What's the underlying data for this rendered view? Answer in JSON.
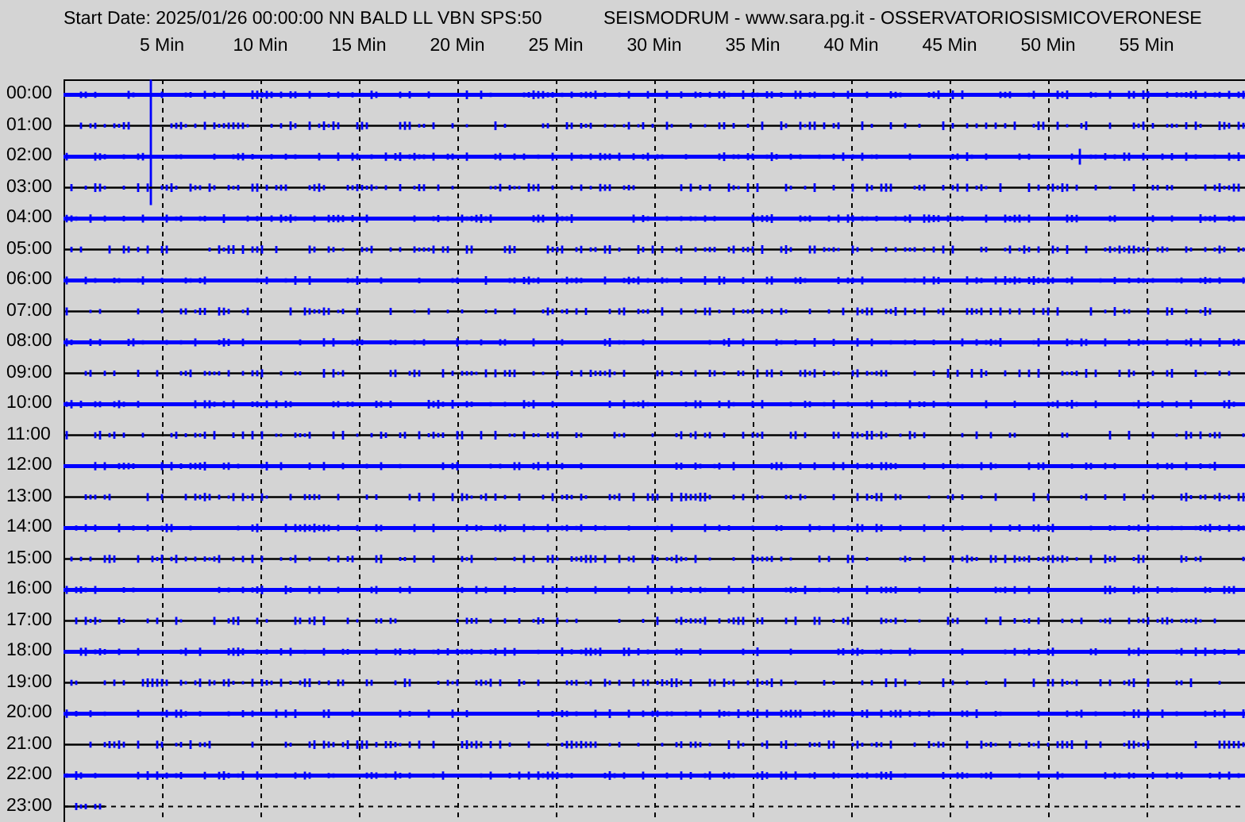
{
  "header": {
    "start_info": "Start Date: 2025/01/26 00:00:00 NN BALD LL VBN SPS:50",
    "source": "SEISMODRUM - www.sara.pg.it - OSSERVATORIOSISMICOVERONESE"
  },
  "minute_labels": [
    "5 Min",
    "10 Min",
    "15 Min",
    "20 Min",
    "25 Min",
    "30 Min",
    "35 Min",
    "40 Min",
    "45 Min",
    "50 Min",
    "55 Min"
  ],
  "rows": [
    {
      "time": "00:00",
      "kind": "full"
    },
    {
      "time": "01:00",
      "kind": "full"
    },
    {
      "time": "02:00",
      "kind": "full"
    },
    {
      "time": "03:00",
      "kind": "full"
    },
    {
      "time": "04:00",
      "kind": "full"
    },
    {
      "time": "05:00",
      "kind": "full"
    },
    {
      "time": "06:00",
      "kind": "full"
    },
    {
      "time": "07:00",
      "kind": "full"
    },
    {
      "time": "08:00",
      "kind": "full"
    },
    {
      "time": "09:00",
      "kind": "full"
    },
    {
      "time": "10:00",
      "kind": "full"
    },
    {
      "time": "11:00",
      "kind": "full"
    },
    {
      "time": "12:00",
      "kind": "full"
    },
    {
      "time": "13:00",
      "kind": "full"
    },
    {
      "time": "14:00",
      "kind": "full"
    },
    {
      "time": "15:00",
      "kind": "full"
    },
    {
      "time": "16:00",
      "kind": "full"
    },
    {
      "time": "17:00",
      "kind": "full"
    },
    {
      "time": "18:00",
      "kind": "full"
    },
    {
      "time": "19:00",
      "kind": "full"
    },
    {
      "time": "20:00",
      "kind": "full"
    },
    {
      "time": "21:00",
      "kind": "full"
    },
    {
      "time": "22:00",
      "kind": "full"
    },
    {
      "time": "23:00",
      "kind": "partial"
    }
  ]
}
